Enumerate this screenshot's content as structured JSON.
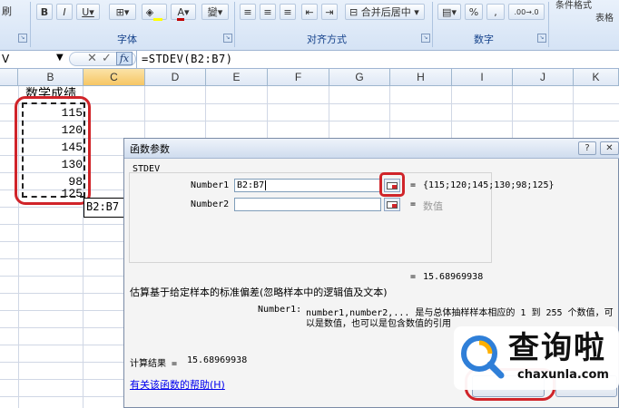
{
  "ribbon": {
    "clipboard_fragment": "刷",
    "font_group_label": "字体",
    "alignment_group_label": "对齐方式",
    "merge_center_label": "合并后居中",
    "number_group_label": "数字",
    "percent_label": "%",
    "comma_label": ",",
    "increase_decimal_label": ".00→.0",
    "conditional_format_label": "条件格式",
    "table_format_label": "表格"
  },
  "formula_bar": {
    "name_box": "V",
    "formula": "=STDEV(B2:B7)"
  },
  "columns": [
    "B",
    "C",
    "D",
    "E",
    "F",
    "G",
    "H",
    "I",
    "J",
    "K"
  ],
  "sheet": {
    "b1": "数学成绩",
    "values": [
      "115",
      "120",
      "145",
      "130",
      "98",
      "125"
    ],
    "c8_fragment": "B2:B7"
  },
  "dialog": {
    "title": "函数参数",
    "function_name": "STDEV",
    "arg1_label": "Number1",
    "arg1_value": "B2:B7",
    "arg1_result": "{115;120;145;130;98;125}",
    "arg2_label": "Number2",
    "arg2_result": "数值",
    "equals": "=",
    "preview_result": "15.68969938",
    "description": "估算基于给定样本的标准偏差(忽略样本中的逻辑值及文本)",
    "param_name": "Number1:",
    "param_desc_1": "number1,number2,... 是与总体抽样样本相应的 1 到 255 个数值，可",
    "param_desc_2": "以是数值，也可以是包含数值的引用",
    "calc_result_label": "计算结果 =",
    "calc_result_value": "15.68969938",
    "help_link": "有关该函数的帮助(H)"
  },
  "watermark": {
    "brand_cn": "查询啦",
    "brand_url": "chaxunla.com"
  },
  "colors": {
    "annotation_red": "#d0242a",
    "ribbon_label_blue": "#15428b",
    "link_blue": "#0000ee"
  }
}
